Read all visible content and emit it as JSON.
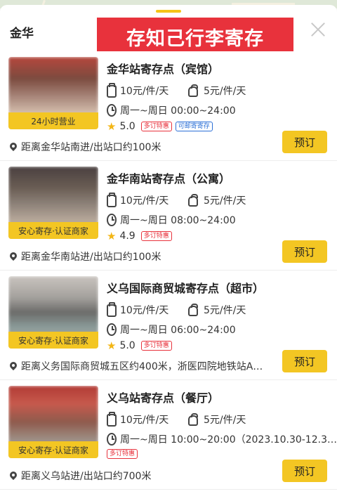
{
  "header": {
    "city": "金华",
    "banner": "存知己行李寄存",
    "accent": "#f3c623",
    "banner_color": "#e8323c"
  },
  "icons": {
    "suitcase": "suitcase-icon",
    "backpack": "backpack-icon",
    "clock": "clock-icon",
    "star": "star-icon",
    "location": "location-pin-icon",
    "close": "close-icon"
  },
  "cards": [
    {
      "name": "金华站寄存点（宾馆）",
      "tag": "24小时营业",
      "price_suitcase": "10元/件/天",
      "price_backpack": "5元/件/天",
      "hours": "周一~周日 00:00~24:00",
      "rating": "5.0",
      "badges": [
        "多订特惠",
        "可邮寄寄存"
      ],
      "address": "距离金华站南进/出站口约100米",
      "book": "预订"
    },
    {
      "name": "金华南站寄存点（公寓）",
      "tag": "安心寄存·认证商家",
      "price_suitcase": "10元/件/天",
      "price_backpack": "5元/件/天",
      "hours": "周一~周日 08:00~24:00",
      "rating": "4.9",
      "badges": [
        "多订特惠"
      ],
      "address": "距离金华南站进/出站口约100米",
      "book": "预订"
    },
    {
      "name": "义乌国际商贸城寄存点（超市）",
      "tag": "安心寄存·认证商家",
      "price_suitcase": "10元/件/天",
      "price_backpack": "5元/件/天",
      "hours": "周一~周日 06:00~24:00",
      "rating": "5.0",
      "badges": [
        "多订特惠"
      ],
      "address": "距离义务国际商贸城五区约400米，浙医四院地铁站A…",
      "book": "预订"
    },
    {
      "name": "义乌站寄存点（餐厅）",
      "tag": "安心寄存·认证商家",
      "price_suitcase": "10元/件/天",
      "price_backpack": "5元/件/天",
      "hours": "周一~周日 10:00~20:00（2023.10.30-12.3…",
      "rating": "",
      "badges": [
        "多订特惠"
      ],
      "address": "距离义乌站进/出站口约700米",
      "book": "预订"
    }
  ]
}
